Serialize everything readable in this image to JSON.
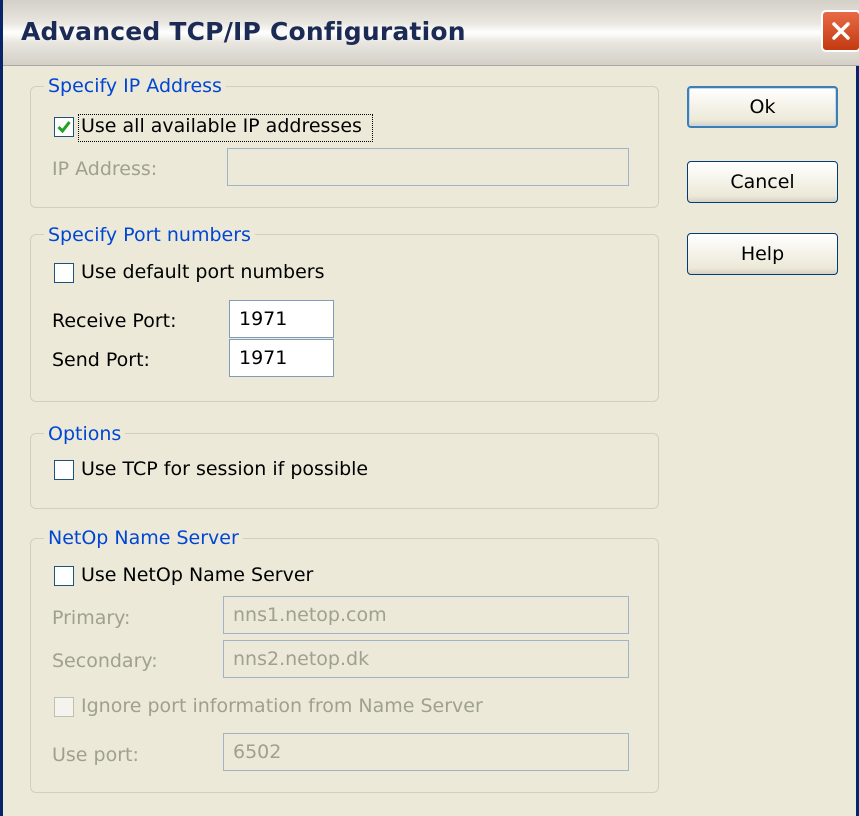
{
  "window": {
    "title": "Advanced TCP/IP Configuration"
  },
  "buttons": {
    "ok": "Ok",
    "cancel": "Cancel",
    "help": "Help"
  },
  "ip_group": {
    "legend": "Specify IP Address",
    "use_all_label": "Use all available IP addresses",
    "use_all_checked": true,
    "ip_address_label": "IP Address:",
    "ip_address_value": ""
  },
  "port_group": {
    "legend": "Specify Port numbers",
    "use_default_label": "Use default port numbers",
    "use_default_checked": false,
    "receive_label": "Receive Port:",
    "receive_value": "1971",
    "send_label": "Send Port:",
    "send_value": "1971"
  },
  "options_group": {
    "legend": "Options",
    "use_tcp_label": "Use TCP for session if possible",
    "use_tcp_checked": false
  },
  "ns_group": {
    "legend": "NetOp Name Server",
    "use_ns_label": "Use NetOp Name Server",
    "use_ns_checked": false,
    "primary_label": "Primary:",
    "primary_value": "nns1.netop.com",
    "secondary_label": "Secondary:",
    "secondary_value": "nns2.netop.dk",
    "ignore_label": "Ignore port information from Name Server",
    "ignore_checked": false,
    "use_port_label": "Use port:",
    "use_port_value": "6502"
  },
  "colors": {
    "accent": "#0046d5",
    "close": "#c33a11",
    "check": "#21a121"
  }
}
